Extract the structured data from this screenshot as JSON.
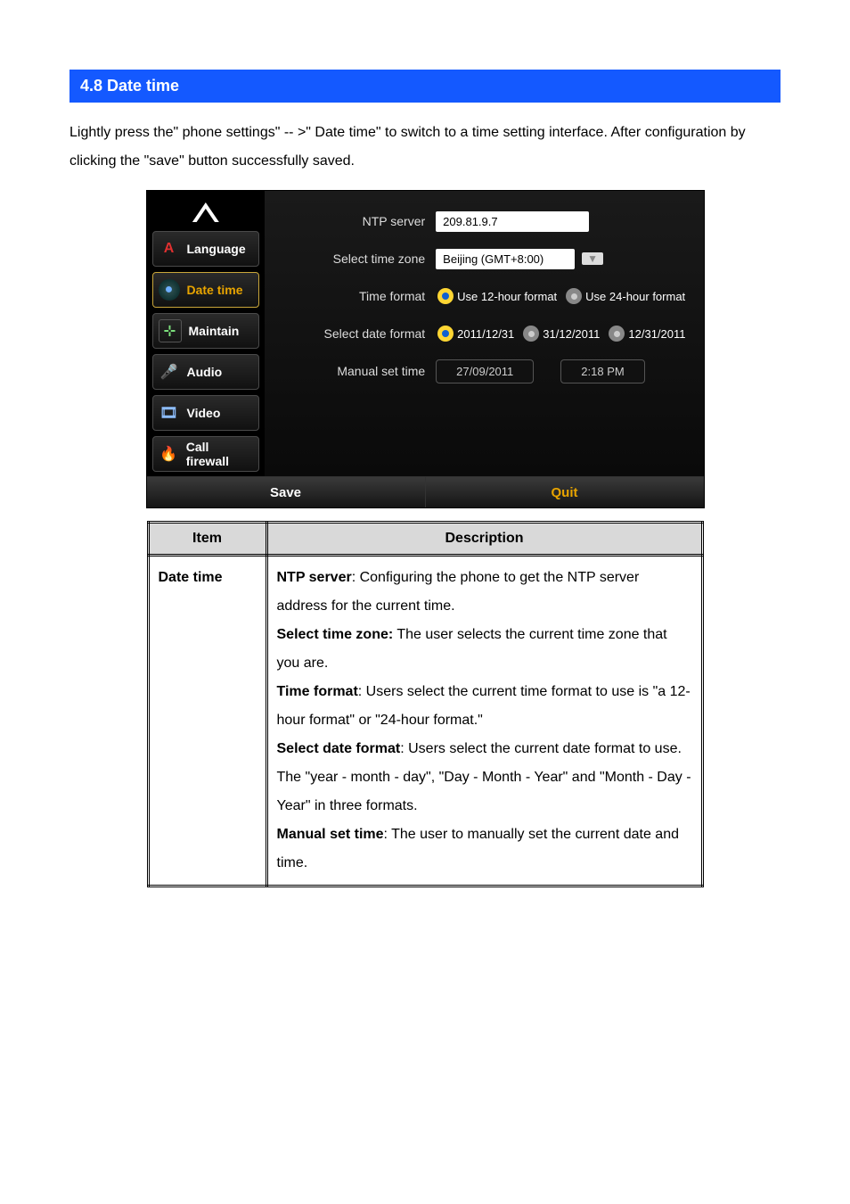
{
  "section": {
    "title": "4.8 Date time"
  },
  "intro": "Lightly press the\" phone settings\" -- >\" Date time\" to switch to a time setting interface. After configuration by clicking the \"save\" button successfully saved.",
  "sidebar": {
    "items": [
      {
        "label": "Language",
        "icon": "A"
      },
      {
        "label": "Date time",
        "icon": "●"
      },
      {
        "label": "Maintain",
        "icon": "⊹"
      },
      {
        "label": "Audio",
        "icon": "🎤"
      },
      {
        "label": "Video",
        "icon": "🎞"
      },
      {
        "label": "Call firewall",
        "icon": "🔥"
      }
    ]
  },
  "form": {
    "ntp": {
      "label": "NTP server",
      "value": "209.81.9.7"
    },
    "tz": {
      "label": "Select time zone",
      "value": "Beijing (GMT+8:00)"
    },
    "timefmt": {
      "label": "Time format",
      "opt1": "Use 12-hour format",
      "opt2": "Use 24-hour format",
      "selected": 1
    },
    "datefmt": {
      "label": "Select date format",
      "opt1": "2011/12/31",
      "opt2": "31/12/2011",
      "opt3": "12/31/2011",
      "selected": 1
    },
    "manual": {
      "label": "Manual set time",
      "date": "27/09/2011",
      "time": "2:18 PM"
    }
  },
  "footer": {
    "save": "Save",
    "quit": "Quit"
  },
  "table": {
    "h_item": "Item",
    "h_desc": "Description",
    "item": "Date time",
    "d1a": "NTP server",
    "d1b": ": Configuring the phone to get the NTP server address for the current time.",
    "d2a": "Select time zone:",
    "d2b": " The user selects the current time zone that you are.",
    "d3a": "Time format",
    "d3b": ": Users select the current time format to use is \"a 12-hour format\" or \"24-hour format.\"",
    "d4a": "Select date format",
    "d4b": ": Users select the current date format to use. The \"year - month - day\", \"Day - Month - Year\" and \"Month - Day - Year\" in three formats.",
    "d5a": "Manual set time",
    "d5b": ": The user to manually set the current date and time."
  }
}
